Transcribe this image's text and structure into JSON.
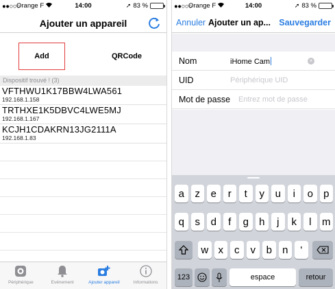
{
  "status_left": {
    "dots": "●●○○○",
    "carrier": "Orange F",
    "time": "14:00",
    "battery": "83 %",
    "battery_level": 0.83
  },
  "status_right": {
    "dots": "●●○○○",
    "carrier": "Orange F",
    "time": "14:00",
    "battery": "83 %",
    "battery_level": 0.83
  },
  "left_screen": {
    "title": "Ajouter un appareil",
    "segments": [
      "Add",
      "QRCode"
    ],
    "section_header": "Dispositif trouvé ! (3)",
    "devices": [
      {
        "name": "VFTHWU1K17BBW4LWA561",
        "ip": "192.168.1.158"
      },
      {
        "name": "TRTHXE1K5DBVC4LWE5MJ",
        "ip": "192.168.1.167"
      },
      {
        "name": "KCJH1CDAKRN13JG2111A",
        "ip": "192.168.1.83"
      }
    ],
    "tabs": [
      "Périphérique",
      "Evénement",
      "Ajouter appareil",
      "Informations"
    ]
  },
  "right_screen": {
    "cancel": "Annuler",
    "title": "Ajouter un ap...",
    "save": "Sauvegarder",
    "fields": [
      {
        "label": "Nom",
        "value": "iHome Cam",
        "placeholder": ""
      },
      {
        "label": "UID",
        "value": "",
        "placeholder": "Périphérique UID"
      },
      {
        "label": "Mot de passe",
        "value": "",
        "placeholder": "Entrez mot de passe"
      }
    ],
    "keyboard": {
      "row1": [
        "a",
        "z",
        "e",
        "r",
        "t",
        "y",
        "u",
        "i",
        "o",
        "p"
      ],
      "row2": [
        "q",
        "s",
        "d",
        "f",
        "g",
        "h",
        "j",
        "k",
        "l",
        "m"
      ],
      "row3": [
        "w",
        "x",
        "c",
        "v",
        "b",
        "n",
        "'"
      ],
      "numbers": "123",
      "space": "espace",
      "return": "retour"
    }
  },
  "colors": {
    "accent": "#2a7de1",
    "highlight_border": "#e23b3b",
    "battery": "#4cd964"
  }
}
